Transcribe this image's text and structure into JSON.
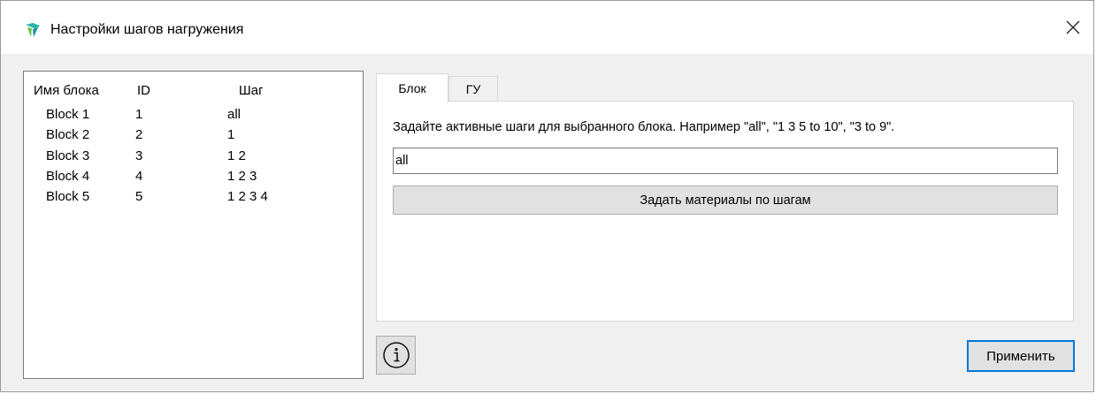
{
  "window": {
    "title": "Настройки шагов нагружения",
    "app_icon": "app-logo-icon",
    "close_icon": "close-icon"
  },
  "block_list": {
    "columns": [
      "Имя блока",
      "ID",
      "Шаг"
    ],
    "rows": [
      [
        "Block 1",
        "1",
        "all"
      ],
      [
        "Block 2",
        "2",
        "1"
      ],
      [
        "Block 3",
        "3",
        "1 2"
      ],
      [
        "Block 4",
        "4",
        "1 2 3"
      ],
      [
        "Block 5",
        "5",
        "1 2 3 4"
      ]
    ]
  },
  "tabs": [
    {
      "label": "Блок",
      "active": true
    },
    {
      "label": "ГУ",
      "active": false
    }
  ],
  "panel": {
    "hint": "Задайте активные шаги для выбранного блока. Например \"all\", \"1 3 5 to 10\", \"3 to 9\".",
    "steps_value": "all",
    "materials_button": "Задать материалы по шагам"
  },
  "footer": {
    "info_icon": "info-icon",
    "apply_button": "Применить"
  },
  "colors": {
    "accent": "#0078d7",
    "logo_teal": "#2bb5a6",
    "logo_green": "#6cc04a"
  }
}
